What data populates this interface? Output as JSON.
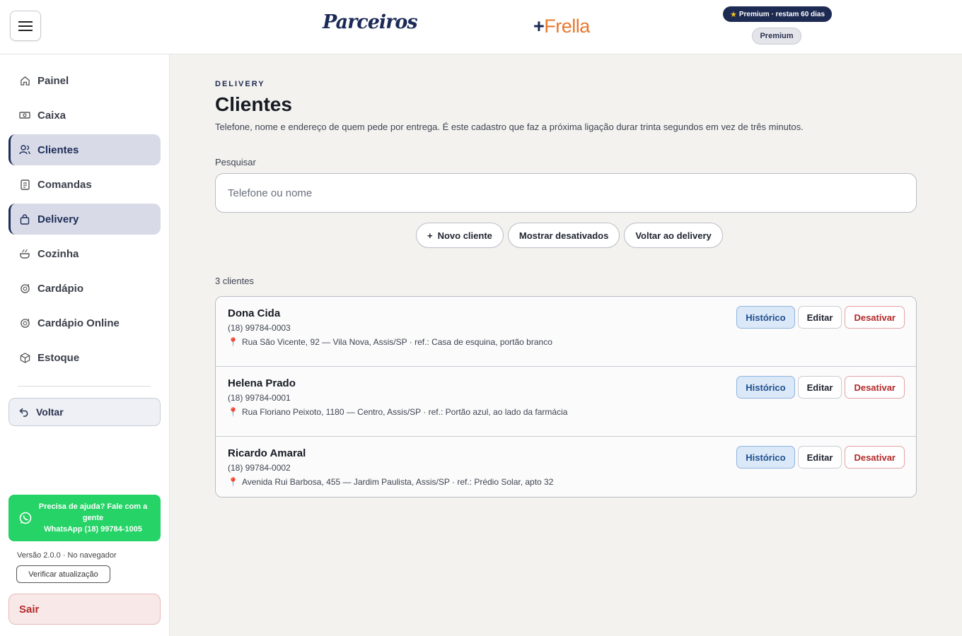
{
  "header": {
    "logo_parceiros": "Parceiros",
    "logo_frella_plus": "+",
    "logo_frella": "Frella",
    "premium_badge": "Premium · restam 60 dias",
    "premium_pill": "Premium"
  },
  "sidebar": {
    "items": [
      {
        "label": "Painel",
        "icon": "home-icon"
      },
      {
        "label": "Caixa",
        "icon": "cash-icon"
      },
      {
        "label": "Clientes",
        "icon": "users-icon"
      },
      {
        "label": "Comandas",
        "icon": "receipt-icon"
      },
      {
        "label": "Delivery",
        "icon": "bag-icon"
      },
      {
        "label": "Cozinha",
        "icon": "pot-icon"
      },
      {
        "label": "Cardápio",
        "icon": "menu-icon"
      },
      {
        "label": "Cardápio Online",
        "icon": "menu-online-icon"
      },
      {
        "label": "Estoque",
        "icon": "box-icon"
      }
    ],
    "voltar": "Voltar",
    "whatsapp_line1": "Precisa de ajuda? Fale com a gente",
    "whatsapp_line2": "WhatsApp (18) 99784-1005",
    "version": "Versão 2.0.0 · No navegador",
    "verify_button": "Verificar atualização",
    "sair": "Sair"
  },
  "main": {
    "eyebrow": "DELIVERY",
    "title": "Clientes",
    "description": "Telefone, nome e endereço de quem pede por entrega. É este cadastro que faz a próxima ligação durar trinta segundos em vez de três minutos.",
    "search_label": "Pesquisar",
    "search_placeholder": "Telefone ou nome",
    "search_value": "",
    "new_client_plus": "+",
    "new_client": "Novo cliente",
    "show_disabled": "Mostrar desativados",
    "back_to_delivery": "Voltar ao delivery",
    "count": "3 clientes",
    "clients": [
      {
        "name": "Dona Cida",
        "phone": "(18) 99784-0003",
        "address": "Rua São Vicente, 92 — Vila Nova, Assis/SP · ref.: Casa de esquina, portão branco"
      },
      {
        "name": "Helena Prado",
        "phone": "(18) 99784-0001",
        "address": "Rua Floriano Peixoto, 1180 — Centro, Assis/SP · ref.: Portão azul, ao lado da farmácia"
      },
      {
        "name": "Ricardo Amaral",
        "phone": "(18) 99784-0002",
        "address": "Avenida Rui Barbosa, 455 — Jardim Paulista, Assis/SP · ref.: Prédio Solar, apto 32"
      }
    ],
    "btn_history": "Histórico",
    "btn_edit": "Editar",
    "btn_deactivate": "Desativar"
  },
  "colors": {
    "accent": "#1e2d5a",
    "whatsapp": "#25d366",
    "danger": "#b22a2a",
    "frella": "#e8772e"
  }
}
